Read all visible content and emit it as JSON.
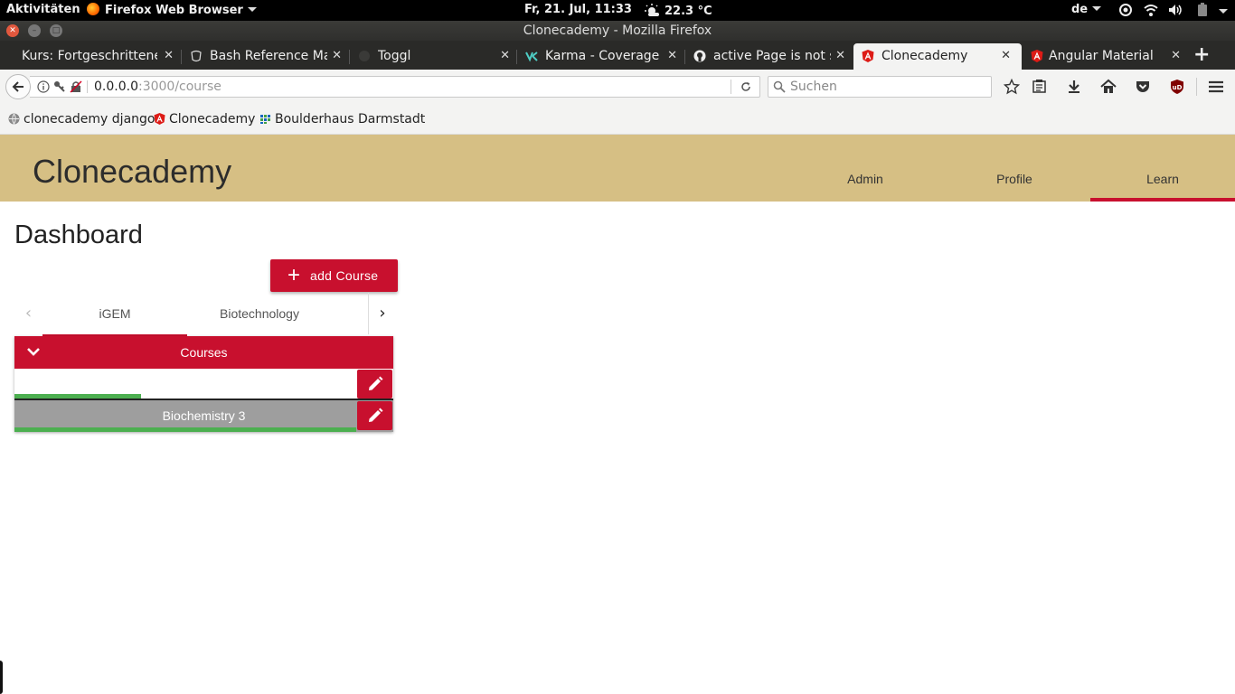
{
  "system": {
    "activities": "Aktivitäten",
    "app_menu": "Firefox Web Browser",
    "clock": "Fr, 21. Jul, 11:33",
    "weather": "22.3 °C",
    "keyboard": "de"
  },
  "window": {
    "title": "Clonecademy - Mozilla Firefox"
  },
  "browser_tabs": [
    {
      "label": "Kurs: Fortgeschrittener",
      "icon": "moodle-icon"
    },
    {
      "label": "Bash Reference Ma",
      "icon": "gnu-icon"
    },
    {
      "label": "Toggl",
      "icon": "toggl-icon"
    },
    {
      "label": "Karma - Coverage",
      "icon": "karma-icon"
    },
    {
      "label": "active Page is not s",
      "icon": "github-icon"
    },
    {
      "label": "Clonecademy",
      "icon": "angular-icon",
      "active": true
    },
    {
      "label": "Angular Material",
      "icon": "angular-icon"
    }
  ],
  "address": {
    "host": "0.0.0.0",
    "path": ":3000/course"
  },
  "search": {
    "placeholder": "Suchen"
  },
  "bookmarks": [
    {
      "label": "clonecademy django",
      "icon": "globe-icon"
    },
    {
      "label": "Clonecademy",
      "icon": "angular-icon"
    },
    {
      "label": "Boulderhaus Darmstadt",
      "icon": "grid-icon"
    }
  ],
  "app": {
    "title": "Clonecademy",
    "nav": [
      "Admin",
      "Profile",
      "Learn"
    ],
    "active_nav": "Learn",
    "accent": "#c8102e",
    "header_bg": "#d6bf84"
  },
  "dashboard": {
    "title": "Dashboard",
    "add_button": "add Course",
    "tabs": [
      "iGEM",
      "Biotechnology"
    ],
    "panel_title": "Courses",
    "courses": [
      {
        "name": "",
        "progress": 0.33
      },
      {
        "name": "Biochemistry 3",
        "progress": 0.9
      }
    ]
  }
}
